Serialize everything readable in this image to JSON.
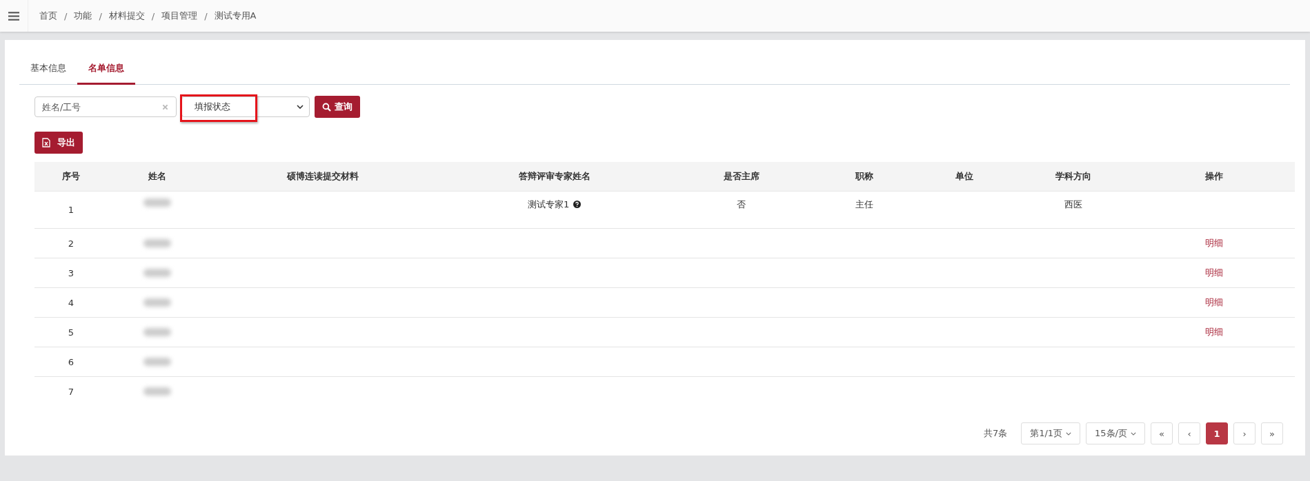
{
  "breadcrumb": [
    "首页",
    "功能",
    "材料提交",
    "项目管理",
    "测试专用A"
  ],
  "breadcrumb_separator": "/",
  "tabs": [
    {
      "label": "基本信息",
      "selected": false
    },
    {
      "label": "名单信息",
      "selected": true
    }
  ],
  "filters": {
    "search": {
      "placeholder": "姓名/工号"
    },
    "status_select": {
      "value": "填报状态"
    },
    "query_button": "查询"
  },
  "export_button": "导出",
  "table": {
    "columns": [
      "序号",
      "姓名",
      "硕博连读提交材料",
      "答辩评审专家姓名",
      "是否主席",
      "职称",
      "单位",
      "学科方向",
      "操作"
    ],
    "rows": [
      {
        "index": "1",
        "expert": "测试专家1",
        "expert_help": true,
        "chair": "否",
        "title": "主任",
        "subject": "西医"
      },
      {
        "index": "2",
        "action": "明细"
      },
      {
        "index": "3",
        "action": "明细"
      },
      {
        "index": "4",
        "action": "明细"
      },
      {
        "index": "5",
        "action": "明细"
      },
      {
        "index": "6"
      },
      {
        "index": "7"
      }
    ]
  },
  "pagination": {
    "total": "共7条",
    "page_select": "第1/1页",
    "size_select": "15条/页",
    "first": "«",
    "prev": "‹",
    "pages": [
      {
        "label": "1",
        "selected": true
      }
    ],
    "next": "›",
    "last": "»"
  }
}
